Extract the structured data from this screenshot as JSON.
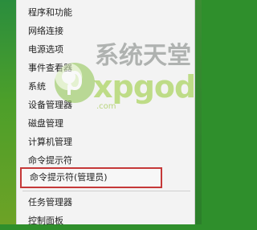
{
  "context_menu": {
    "items": [
      {
        "label": "程序和功能"
      },
      {
        "label": "网络连接"
      },
      {
        "label": "电源选项"
      },
      {
        "label": "事件查看器"
      },
      {
        "label": "系统"
      },
      {
        "label": "设备管理器"
      },
      {
        "label": "磁盘管理"
      },
      {
        "label": "计算机管理"
      },
      {
        "label": "命令提示符"
      },
      {
        "label": "命令提示符(管理员)"
      },
      {
        "label": "任务管理器"
      },
      {
        "label": "控制面板"
      }
    ]
  },
  "watermark": {
    "top_text": "系统天堂",
    "main_text": "xpgod",
    "sub_text": ".com"
  },
  "colors": {
    "menu_background": "#f3f3f3",
    "highlight_border": "#c53838",
    "desktop_green": "#2f8f2c"
  }
}
